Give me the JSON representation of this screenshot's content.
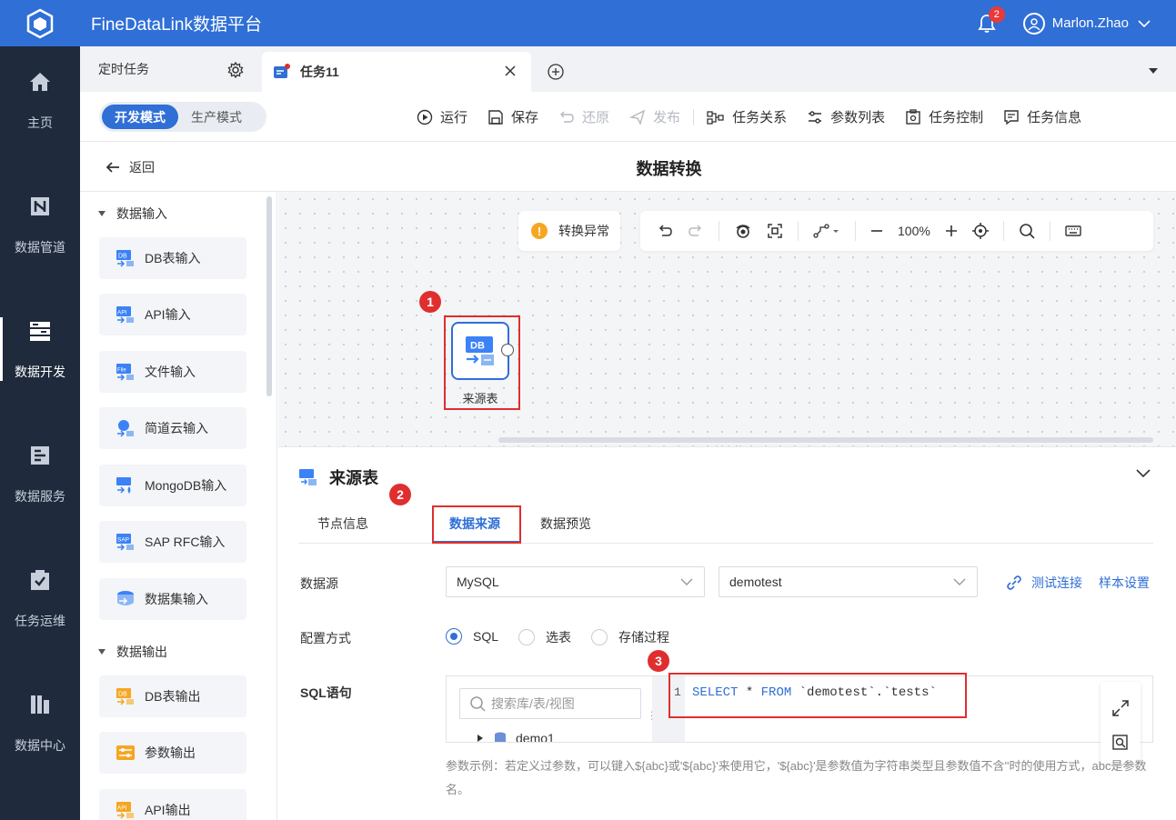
{
  "app": {
    "title": "FineDataLink数据平台"
  },
  "notifications": {
    "count": "2"
  },
  "user": {
    "name": "Marlon.Zhao"
  },
  "leftnav": [
    {
      "label": "主页",
      "icon": "home-icon"
    },
    {
      "label": "数据管道",
      "icon": "pipeline-icon"
    },
    {
      "label": "数据开发",
      "icon": "dev-icon",
      "active": true
    },
    {
      "label": "数据服务",
      "icon": "service-icon"
    },
    {
      "label": "任务运维",
      "icon": "ops-icon"
    },
    {
      "label": "数据中心",
      "icon": "center-icon"
    }
  ],
  "tabs": {
    "scheduled": "定时任务",
    "current": "任务11"
  },
  "modes": {
    "dev": "开发模式",
    "prod": "生产模式"
  },
  "toolbar": {
    "run": "运行",
    "save": "保存",
    "undo": "还原",
    "publish": "发布",
    "relations": "任务关系",
    "params": "参数列表",
    "control": "任务控制",
    "info": "任务信息"
  },
  "header": {
    "back": "返回",
    "title": "数据转换"
  },
  "palette": {
    "input_group": "数据输入",
    "output_group": "数据输出",
    "inputs": [
      "DB表输入",
      "API输入",
      "文件输入",
      "简道云输入",
      "MongoDB输入",
      "SAP RFC输入",
      "数据集输入"
    ],
    "outputs": [
      "DB表输出",
      "参数输出",
      "API输出"
    ]
  },
  "canvas": {
    "warning": "转换异常",
    "zoom": "100%",
    "node_label": "来源表",
    "node_icon_text": "DB"
  },
  "markers": [
    "1",
    "2",
    "3"
  ],
  "props": {
    "title": "来源表",
    "tabs": [
      "节点信息",
      "数据来源",
      "数据预览"
    ],
    "datasource_label": "数据源",
    "datasource_type": "MySQL",
    "datasource_name": "demotest",
    "test_link": "测试连接",
    "sample_link": "样本设置",
    "config_label": "配置方式",
    "config_options": [
      "SQL",
      "选表",
      "存储过程"
    ],
    "sql_label": "SQL语句",
    "search_placeholder": "搜索库/表/视图",
    "tree_item": "demo1",
    "line_no": "1",
    "sql_kw1": "SELECT",
    "sql_star": " * ",
    "sql_kw2": "FROM",
    "sql_rest": " `demotest`.`tests`",
    "hint": "参数示例：若定义过参数，可以键入${abc}或'${abc}'来使用它，'${abc}'是参数值为字符串类型且参数值不含''时的使用方式，abc是参数名。"
  },
  "colors": {
    "brand": "#2f6fd6",
    "nav_bg": "#1f2a3c",
    "highlight": "#e02e2e",
    "warning": "#f5a623"
  }
}
